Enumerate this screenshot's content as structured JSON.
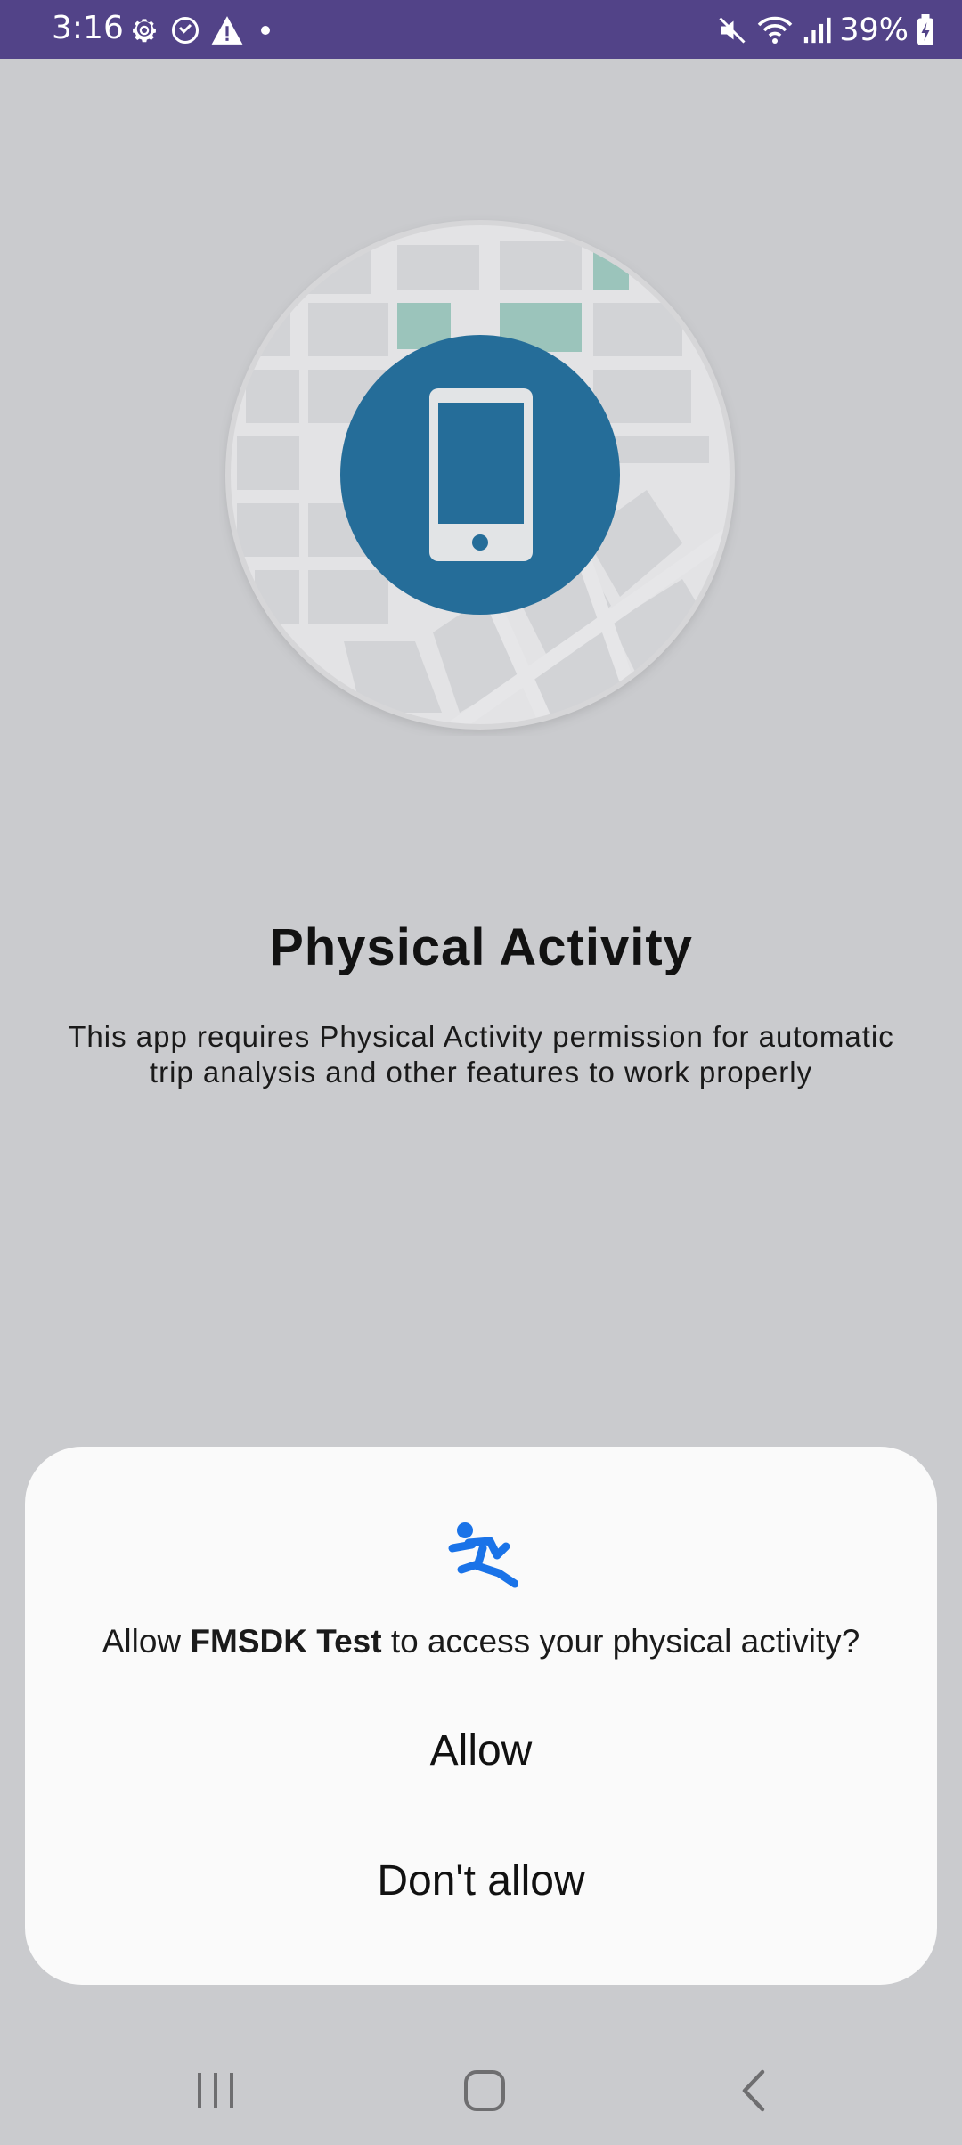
{
  "status_bar": {
    "time": "3:16",
    "battery": "39%",
    "left_icons": [
      "gear-icon",
      "sync-icon",
      "warning-icon",
      "dot-icon"
    ],
    "right_icons": [
      "mute-icon",
      "wifi-icon",
      "signal-icon",
      "battery-charging-icon"
    ],
    "bg_color": "#524388"
  },
  "hero": {
    "icon": "smartphone-icon",
    "circle_color": "#256d99"
  },
  "screen": {
    "title": "Physical Activity",
    "description": "This app requires Physical Activity permission for automatic trip analysis and other features to work properly"
  },
  "dialog": {
    "icon": "running-person-icon",
    "icon_color": "#1a73e8",
    "prompt_prefix": "Allow ",
    "app_name": "FMSDK Test",
    "prompt_suffix": " to access your physical activity?",
    "allow_label": "Allow",
    "deny_label": "Don't allow"
  },
  "nav_bar": {
    "buttons": [
      "recents-icon",
      "home-icon",
      "back-icon"
    ]
  }
}
